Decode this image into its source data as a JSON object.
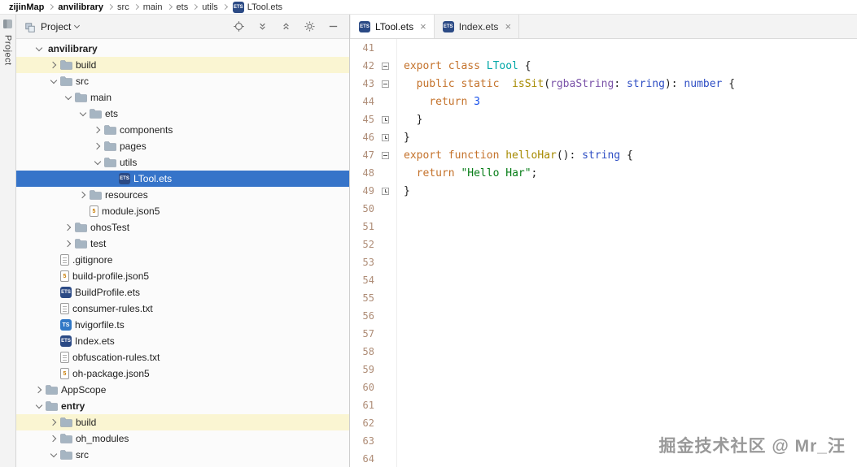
{
  "breadcrumb": {
    "items": [
      {
        "label": "zijinMap",
        "bold": true
      },
      {
        "label": "anvilibrary",
        "bold": true
      },
      {
        "label": "src"
      },
      {
        "label": "main"
      },
      {
        "label": "ets"
      },
      {
        "label": "utils"
      },
      {
        "label": "LTool.ets",
        "icon": "ets"
      }
    ]
  },
  "tool_strip": {
    "project_label": "Project"
  },
  "project_panel": {
    "header": {
      "title": "Project",
      "actions": [
        "locate",
        "expand-all",
        "collapse-all",
        "settings",
        "hide"
      ]
    },
    "tree": [
      {
        "label": "anvilibrary",
        "indent": 0,
        "chevron": "expanded",
        "bold": true
      },
      {
        "label": "build",
        "indent": 1,
        "chevron": "collapsed",
        "icon": "folder",
        "row": "excluded"
      },
      {
        "label": "src",
        "indent": 1,
        "chevron": "expanded",
        "icon": "folder"
      },
      {
        "label": "main",
        "indent": 2,
        "chevron": "expanded",
        "icon": "folder"
      },
      {
        "label": "ets",
        "indent": 3,
        "chevron": "expanded",
        "icon": "folder"
      },
      {
        "label": "components",
        "indent": 4,
        "chevron": "collapsed",
        "icon": "folder"
      },
      {
        "label": "pages",
        "indent": 4,
        "chevron": "collapsed",
        "icon": "folder"
      },
      {
        "label": "utils",
        "indent": 4,
        "chevron": "expanded",
        "icon": "folder"
      },
      {
        "label": "LTool.ets",
        "indent": 5,
        "icon": "ets",
        "row": "selected"
      },
      {
        "label": "resources",
        "indent": 3,
        "chevron": "collapsed",
        "icon": "folder"
      },
      {
        "label": "module.json5",
        "indent": 3,
        "icon": "json"
      },
      {
        "label": "ohosTest",
        "indent": 2,
        "chevron": "collapsed",
        "icon": "folder"
      },
      {
        "label": "test",
        "indent": 2,
        "chevron": "collapsed",
        "icon": "folder"
      },
      {
        "label": ".gitignore",
        "indent": 1,
        "icon": "git"
      },
      {
        "label": "build-profile.json5",
        "indent": 1,
        "icon": "json"
      },
      {
        "label": "BuildProfile.ets",
        "indent": 1,
        "icon": "ets"
      },
      {
        "label": "consumer-rules.txt",
        "indent": 1,
        "icon": "txt"
      },
      {
        "label": "hvigorfile.ts",
        "indent": 1,
        "icon": "ts"
      },
      {
        "label": "Index.ets",
        "indent": 1,
        "icon": "ets"
      },
      {
        "label": "obfuscation-rules.txt",
        "indent": 1,
        "icon": "txt"
      },
      {
        "label": "oh-package.json5",
        "indent": 1,
        "icon": "json"
      },
      {
        "label": "AppScope",
        "indent": 0,
        "chevron": "collapsed",
        "icon": "folder"
      },
      {
        "label": "entry",
        "indent": 0,
        "chevron": "expanded",
        "icon": "folder",
        "bold": true
      },
      {
        "label": "build",
        "indent": 1,
        "chevron": "collapsed",
        "icon": "folder",
        "row": "excluded"
      },
      {
        "label": "oh_modules",
        "indent": 1,
        "chevron": "collapsed",
        "icon": "folder"
      },
      {
        "label": "src",
        "indent": 1,
        "chevron": "expanded",
        "icon": "folder"
      }
    ]
  },
  "editor": {
    "tabs": [
      {
        "label": "LTool.ets",
        "icon": "ets",
        "active": true
      },
      {
        "label": "Index.ets",
        "icon": "ets",
        "active": false
      }
    ],
    "gutter": {
      "first_line": 41,
      "last_line": 64
    },
    "code": {
      "42": {
        "fold": "start",
        "tokens": [
          [
            "kw",
            "export class"
          ],
          [
            "pl",
            " "
          ],
          [
            "cls",
            "LTool"
          ],
          [
            "pl",
            " {"
          ]
        ]
      },
      "43": {
        "fold": "start",
        "tokens": [
          [
            "pl",
            "  "
          ],
          [
            "kw",
            "public static"
          ],
          [
            "pl",
            "  "
          ],
          [
            "fn",
            "isSit"
          ],
          [
            "pl",
            "("
          ],
          [
            "par",
            "rgbaString"
          ],
          [
            "pl",
            ": "
          ],
          [
            "typ",
            "string"
          ],
          [
            "pl",
            "): "
          ],
          [
            "typ",
            "number"
          ],
          [
            "pl",
            " {"
          ]
        ]
      },
      "44": {
        "tokens": [
          [
            "pl",
            "    "
          ],
          [
            "kw",
            "return"
          ],
          [
            "pl",
            " "
          ],
          [
            "num",
            "3"
          ]
        ]
      },
      "45": {
        "fold": "end",
        "tokens": [
          [
            "pl",
            "  }"
          ]
        ]
      },
      "46": {
        "fold": "end",
        "tokens": [
          [
            "pl",
            "}"
          ]
        ]
      },
      "47": {
        "fold": "start",
        "tokens": [
          [
            "kw",
            "export function"
          ],
          [
            "pl",
            " "
          ],
          [
            "fn",
            "helloHar"
          ],
          [
            "pl",
            "(): "
          ],
          [
            "typ",
            "string"
          ],
          [
            "pl",
            " {"
          ]
        ]
      },
      "48": {
        "tokens": [
          [
            "pl",
            "  "
          ],
          [
            "kw",
            "return"
          ],
          [
            "pl",
            " "
          ],
          [
            "str",
            "\"Hello Har\""
          ],
          [
            "pl",
            ";"
          ]
        ]
      },
      "49": {
        "fold": "end",
        "tokens": [
          [
            "pl",
            "}"
          ]
        ]
      }
    },
    "watermark": "掘金技术社区 @ Mr_汪"
  },
  "colors": {
    "selection_blue": "#3674C9",
    "excluded_yellow": "#FAF5D2",
    "keyword": "#C4722B",
    "class_name": "#00A7A7",
    "function_name": "#A68A00",
    "parameter": "#7A52A8",
    "type_name": "#2E4EC4",
    "number": "#1750EB",
    "string": "#067D17",
    "line_number": "#AE8C76",
    "ets_badge": "#2B4A85",
    "ts_badge": "#3178C6"
  }
}
